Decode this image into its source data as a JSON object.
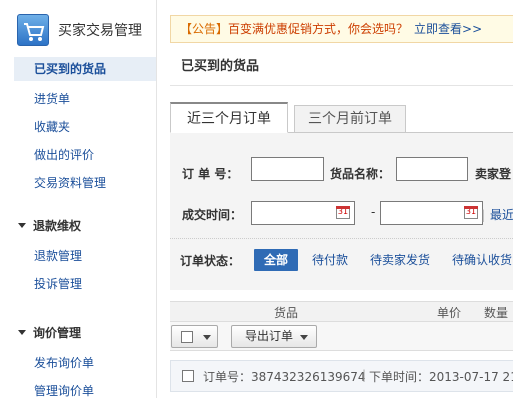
{
  "sidebar": {
    "title": "买家交易管理",
    "items": [
      "已买到的货品",
      "进货单",
      "收藏夹",
      "做出的评价",
      "交易资料管理"
    ],
    "groups": [
      {
        "label": "退款维权",
        "items": [
          "退款管理",
          "投诉管理"
        ]
      },
      {
        "label": "询价管理",
        "items": [
          "发布询价单",
          "管理询价单"
        ]
      }
    ]
  },
  "notice": {
    "tag": "【公告】",
    "message": "百变满优惠促销方式，你会选吗？",
    "link": "立即查看>>"
  },
  "page_title": "已买到的货品",
  "tabs": [
    "近三个月订单",
    "三个月前订单"
  ],
  "filters": {
    "order_no_label": "订 单 号：",
    "goods_name_label": "货品名称：",
    "seller_label": "卖家登",
    "deal_time_label": "成交时间：",
    "date_separator": "-",
    "latest_link": "最近",
    "status_label": "订单状态：",
    "statuses": [
      "全部",
      "待付款",
      "待卖家发货",
      "待确认收货"
    ]
  },
  "table": {
    "headers": {
      "goods": "货品",
      "price": "单价",
      "qty": "数量"
    },
    "export_label": "导出订单"
  },
  "order": {
    "number": "订单号：387432326139674",
    "time": "下单时间：2013-07-17 21:"
  }
}
